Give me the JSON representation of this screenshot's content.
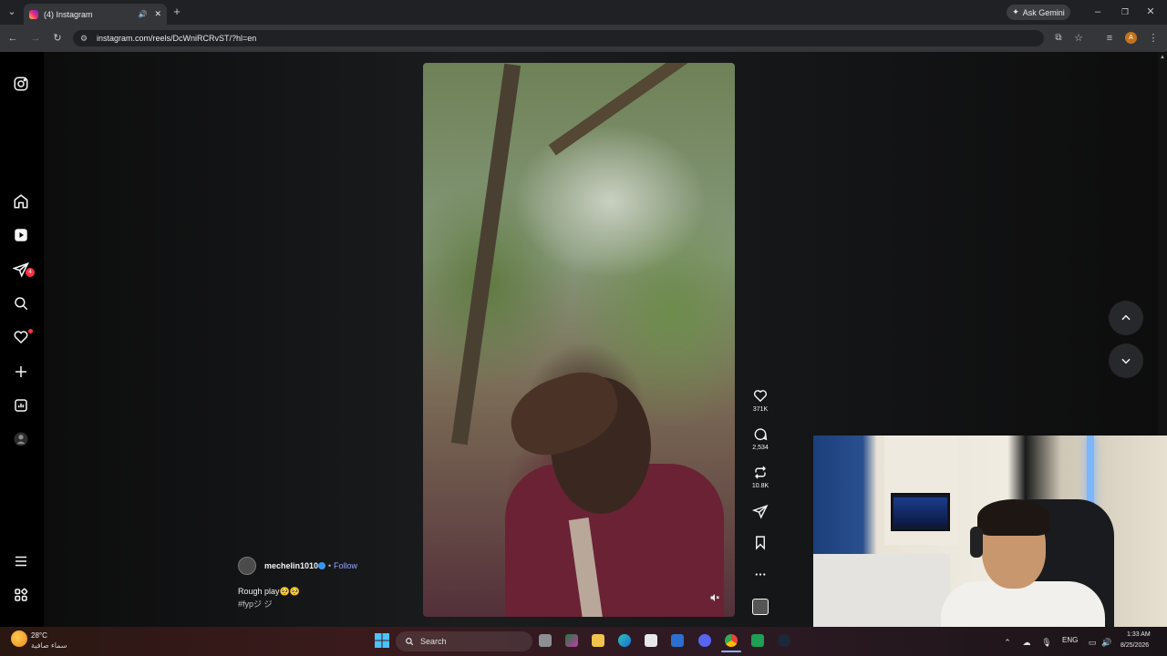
{
  "browser": {
    "tab_title": "(4) Instagram",
    "url": "instagram.com/reels/DcWniRCRvST/?hl=en",
    "ask_gemini": "Ask Gemini",
    "profile_initial": "A"
  },
  "sidebar": {
    "notifications_badge": "4"
  },
  "reel": {
    "username": "mechelin1010",
    "separator": "•",
    "follow_label": "Follow",
    "caption": "Rough play🥺🥺",
    "hashtag": "#fypジ ジ"
  },
  "actions": {
    "likes": "371K",
    "comments": "2,534",
    "reposts": "10.8K"
  },
  "taskbar": {
    "temperature": "28°C",
    "weather_condition": "سماء صافية",
    "search_placeholder": "Search",
    "language": "ENG",
    "time": "1:33 AM",
    "date": "8/25/2026"
  },
  "colors": {
    "instagram_bg": "#000000",
    "link_blue": "#9aa5ff",
    "verified_blue": "#3797f0",
    "notification_red": "#ff3040"
  }
}
